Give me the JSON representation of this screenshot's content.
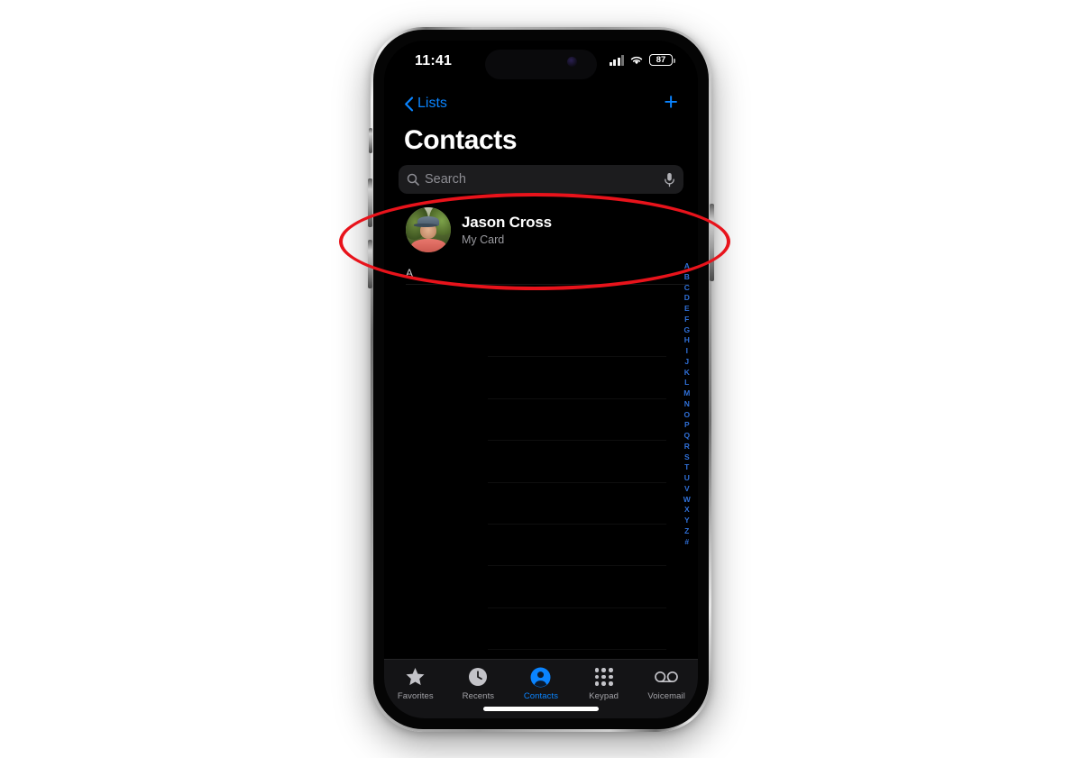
{
  "device": {
    "kind": "iphone-mockup",
    "frame_color": "#9a9a9a",
    "screen_bg": "#000000"
  },
  "status_bar": {
    "time": "11:41",
    "cellular_icon": "cellular-bars-icon",
    "wifi_icon": "wifi-icon",
    "battery_level": "87",
    "dynamic_island": "dynamic-island",
    "front_camera": "front-camera-icon"
  },
  "nav_bar": {
    "back_label": "Lists",
    "back_icon": "chevron-left-icon",
    "add_icon": "plus-icon",
    "accent_color": "#0a84ff"
  },
  "header": {
    "title": "Contacts"
  },
  "search": {
    "placeholder": "Search",
    "search_icon": "magnifier-icon",
    "dictate_icon": "microphone-icon"
  },
  "my_card": {
    "name": "Jason Cross",
    "subtitle": "My Card",
    "avatar_icon": "contact-photo-avatar"
  },
  "contact_list": {
    "section_header": "A",
    "empty_row_count": 9,
    "index_letters": [
      "A",
      "B",
      "C",
      "D",
      "E",
      "F",
      "G",
      "H",
      "I",
      "J",
      "K",
      "L",
      "M",
      "N",
      "O",
      "P",
      "Q",
      "R",
      "S",
      "T",
      "U",
      "V",
      "W",
      "X",
      "Y",
      "Z",
      "#"
    ],
    "index_color": "#2f6fd6"
  },
  "tab_bar": {
    "active_color": "#0a84ff",
    "inactive_color": "#a2a2a7",
    "tabs": [
      {
        "label": "Favorites",
        "icon": "star-icon",
        "active": false
      },
      {
        "label": "Recents",
        "icon": "clock-icon",
        "active": false
      },
      {
        "label": "Contacts",
        "icon": "person-circle-icon",
        "active": true
      },
      {
        "label": "Keypad",
        "icon": "keypad-grid-icon",
        "active": false
      },
      {
        "label": "Voicemail",
        "icon": "voicemail-icon",
        "active": false
      }
    ]
  },
  "annotation": {
    "shape": "ellipse",
    "color": "#e8131b",
    "target": "Jason Cross My Card row"
  }
}
